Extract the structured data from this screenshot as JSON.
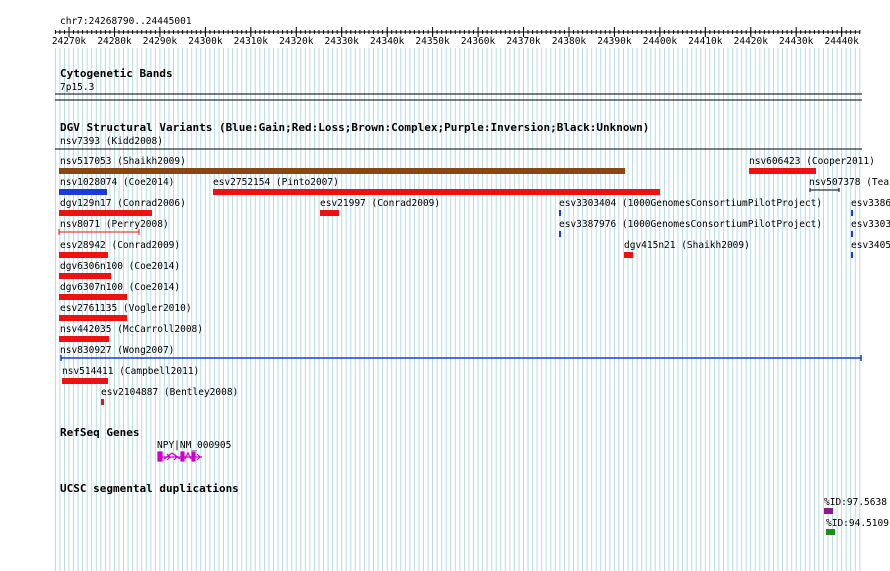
{
  "browser": {
    "position": "chr7:24268790..24445001",
    "ticks": [
      "24270k",
      "24280k",
      "24290k",
      "24300k",
      "24310k",
      "24320k",
      "24330k",
      "24340k",
      "24350k",
      "24360k",
      "24370k",
      "24380k",
      "24390k",
      "24400k",
      "24410k",
      "24420k",
      "24430k",
      "24440k"
    ]
  },
  "cytoband": {
    "title": "Cytogenetic Bands",
    "band": "7p15.3"
  },
  "dgv": {
    "title": "DGV Structural Variants (Blue:Gain;Red:Loss;Brown:Complex;Purple:Inversion;Black:Unknown)",
    "header_label": "nsv7393 (Kidd2008)",
    "features": [
      {
        "label": "nsv517053 (Shaikh2009)",
        "color": "#8b4513"
      },
      {
        "label": "nsv606423 (Cooper2011)",
        "color": "#ee1111"
      },
      {
        "label": "nsv1028074 (Coe2014)",
        "color": "#1a3adb"
      },
      {
        "label": "esv2752154 (Pinto2007)",
        "color": "#ee1111"
      },
      {
        "label": "nsv507378 (Tea",
        "color": "#000000"
      },
      {
        "label": "dgv129n17 (Conrad2006)",
        "color": "#ee1111"
      },
      {
        "label": "esv21997 (Conrad2009)",
        "color": "#ee1111"
      },
      {
        "label": "esv3303404 (1000GenomesConsortiumPilotProject)",
        "color": "#1a3adb"
      },
      {
        "label": "esv3386",
        "color": "#1a3adb"
      },
      {
        "label": "nsv8071 (Perry2008)",
        "color": "#ee1111"
      },
      {
        "label": "esv3387976 (1000GenomesConsortiumPilotProject)",
        "color": "#1a3adb"
      },
      {
        "label": "esv3303",
        "color": "#1a3adb"
      },
      {
        "label": "esv28942 (Conrad2009)",
        "color": "#ee1111"
      },
      {
        "label": "dgv415n21 (Shaikh2009)",
        "color": "#ee1111"
      },
      {
        "label": "esv3405",
        "color": "#1a3adb"
      },
      {
        "label": "dgv6306n100 (Coe2014)",
        "color": "#ee1111"
      },
      {
        "label": "dgv6307n100 (Coe2014)",
        "color": "#ee1111"
      },
      {
        "label": "esv2761135 (Vogler2010)",
        "color": "#ee1111"
      },
      {
        "label": "nsv442035 (McCarroll2008)",
        "color": "#ee1111"
      },
      {
        "label": "nsv830927 (Wong2007)",
        "color": "#1a3adb"
      },
      {
        "label": "nsv514411 (Campbell2011)",
        "color": "#ee1111"
      },
      {
        "label": "esv2104887 (Bentley2008)",
        "color": "#ee1111"
      }
    ]
  },
  "refseq": {
    "title": "RefSeq Genes",
    "gene_label": "NPY|NM_000905",
    "color": "#cc00cc"
  },
  "segdup": {
    "title": "UCSC segmental duplications",
    "items": [
      {
        "label": "%ID:97.5638",
        "color": "#8b1a8b"
      },
      {
        "label": "%ID:94.5109",
        "color": "#228b22"
      }
    ]
  }
}
